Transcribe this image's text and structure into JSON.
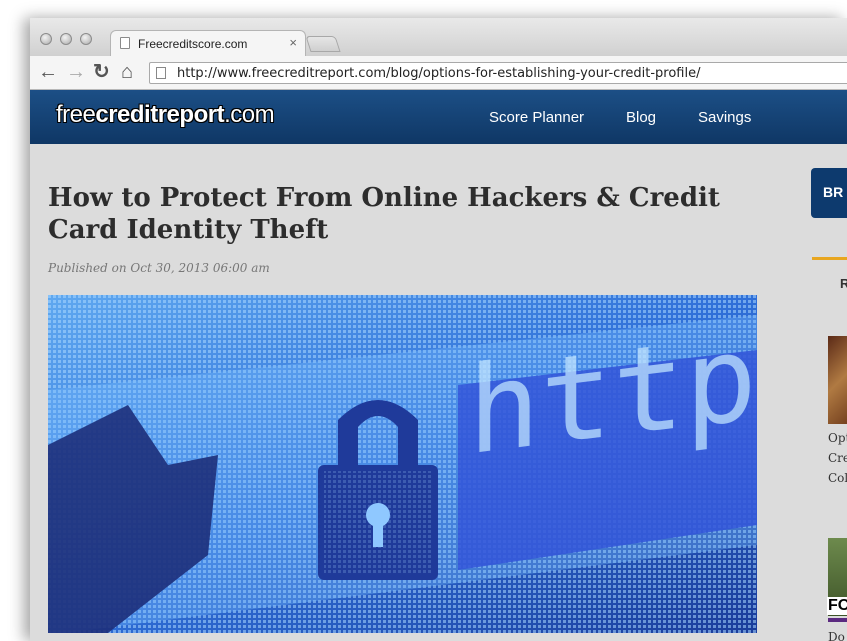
{
  "browser": {
    "tab_title": "Freecreditscore.com",
    "tab_close": "×",
    "url": "http://www.freecreditreport.com/blog/options-for-establishing-your-credit-profile/",
    "back_glyph": "←",
    "forward_glyph": "→",
    "reload_glyph": "↻",
    "home_glyph": "⌂"
  },
  "site": {
    "logo_light": "free",
    "logo_bold": "creditreport",
    "logo_suffix": ".com",
    "nav": [
      {
        "label": "Score Planner"
      },
      {
        "label": "Blog"
      },
      {
        "label": "Savings"
      }
    ]
  },
  "article": {
    "title": "How to Protect From Online Hackers & Credit Card Identity Theft",
    "published": "Published on Oct 30, 2013 06:00 am",
    "hero_text": "https://"
  },
  "sidebar": {
    "button_label": "BR",
    "section_letter": "R",
    "item1_lines": [
      "Opt",
      "Cre",
      "Col"
    ],
    "item2_badge": "FO",
    "item2_line": "Do"
  },
  "colors": {
    "header_blue": "#0f3765",
    "accent_orange": "#e8a620",
    "page_bg": "#dcdcdc"
  }
}
